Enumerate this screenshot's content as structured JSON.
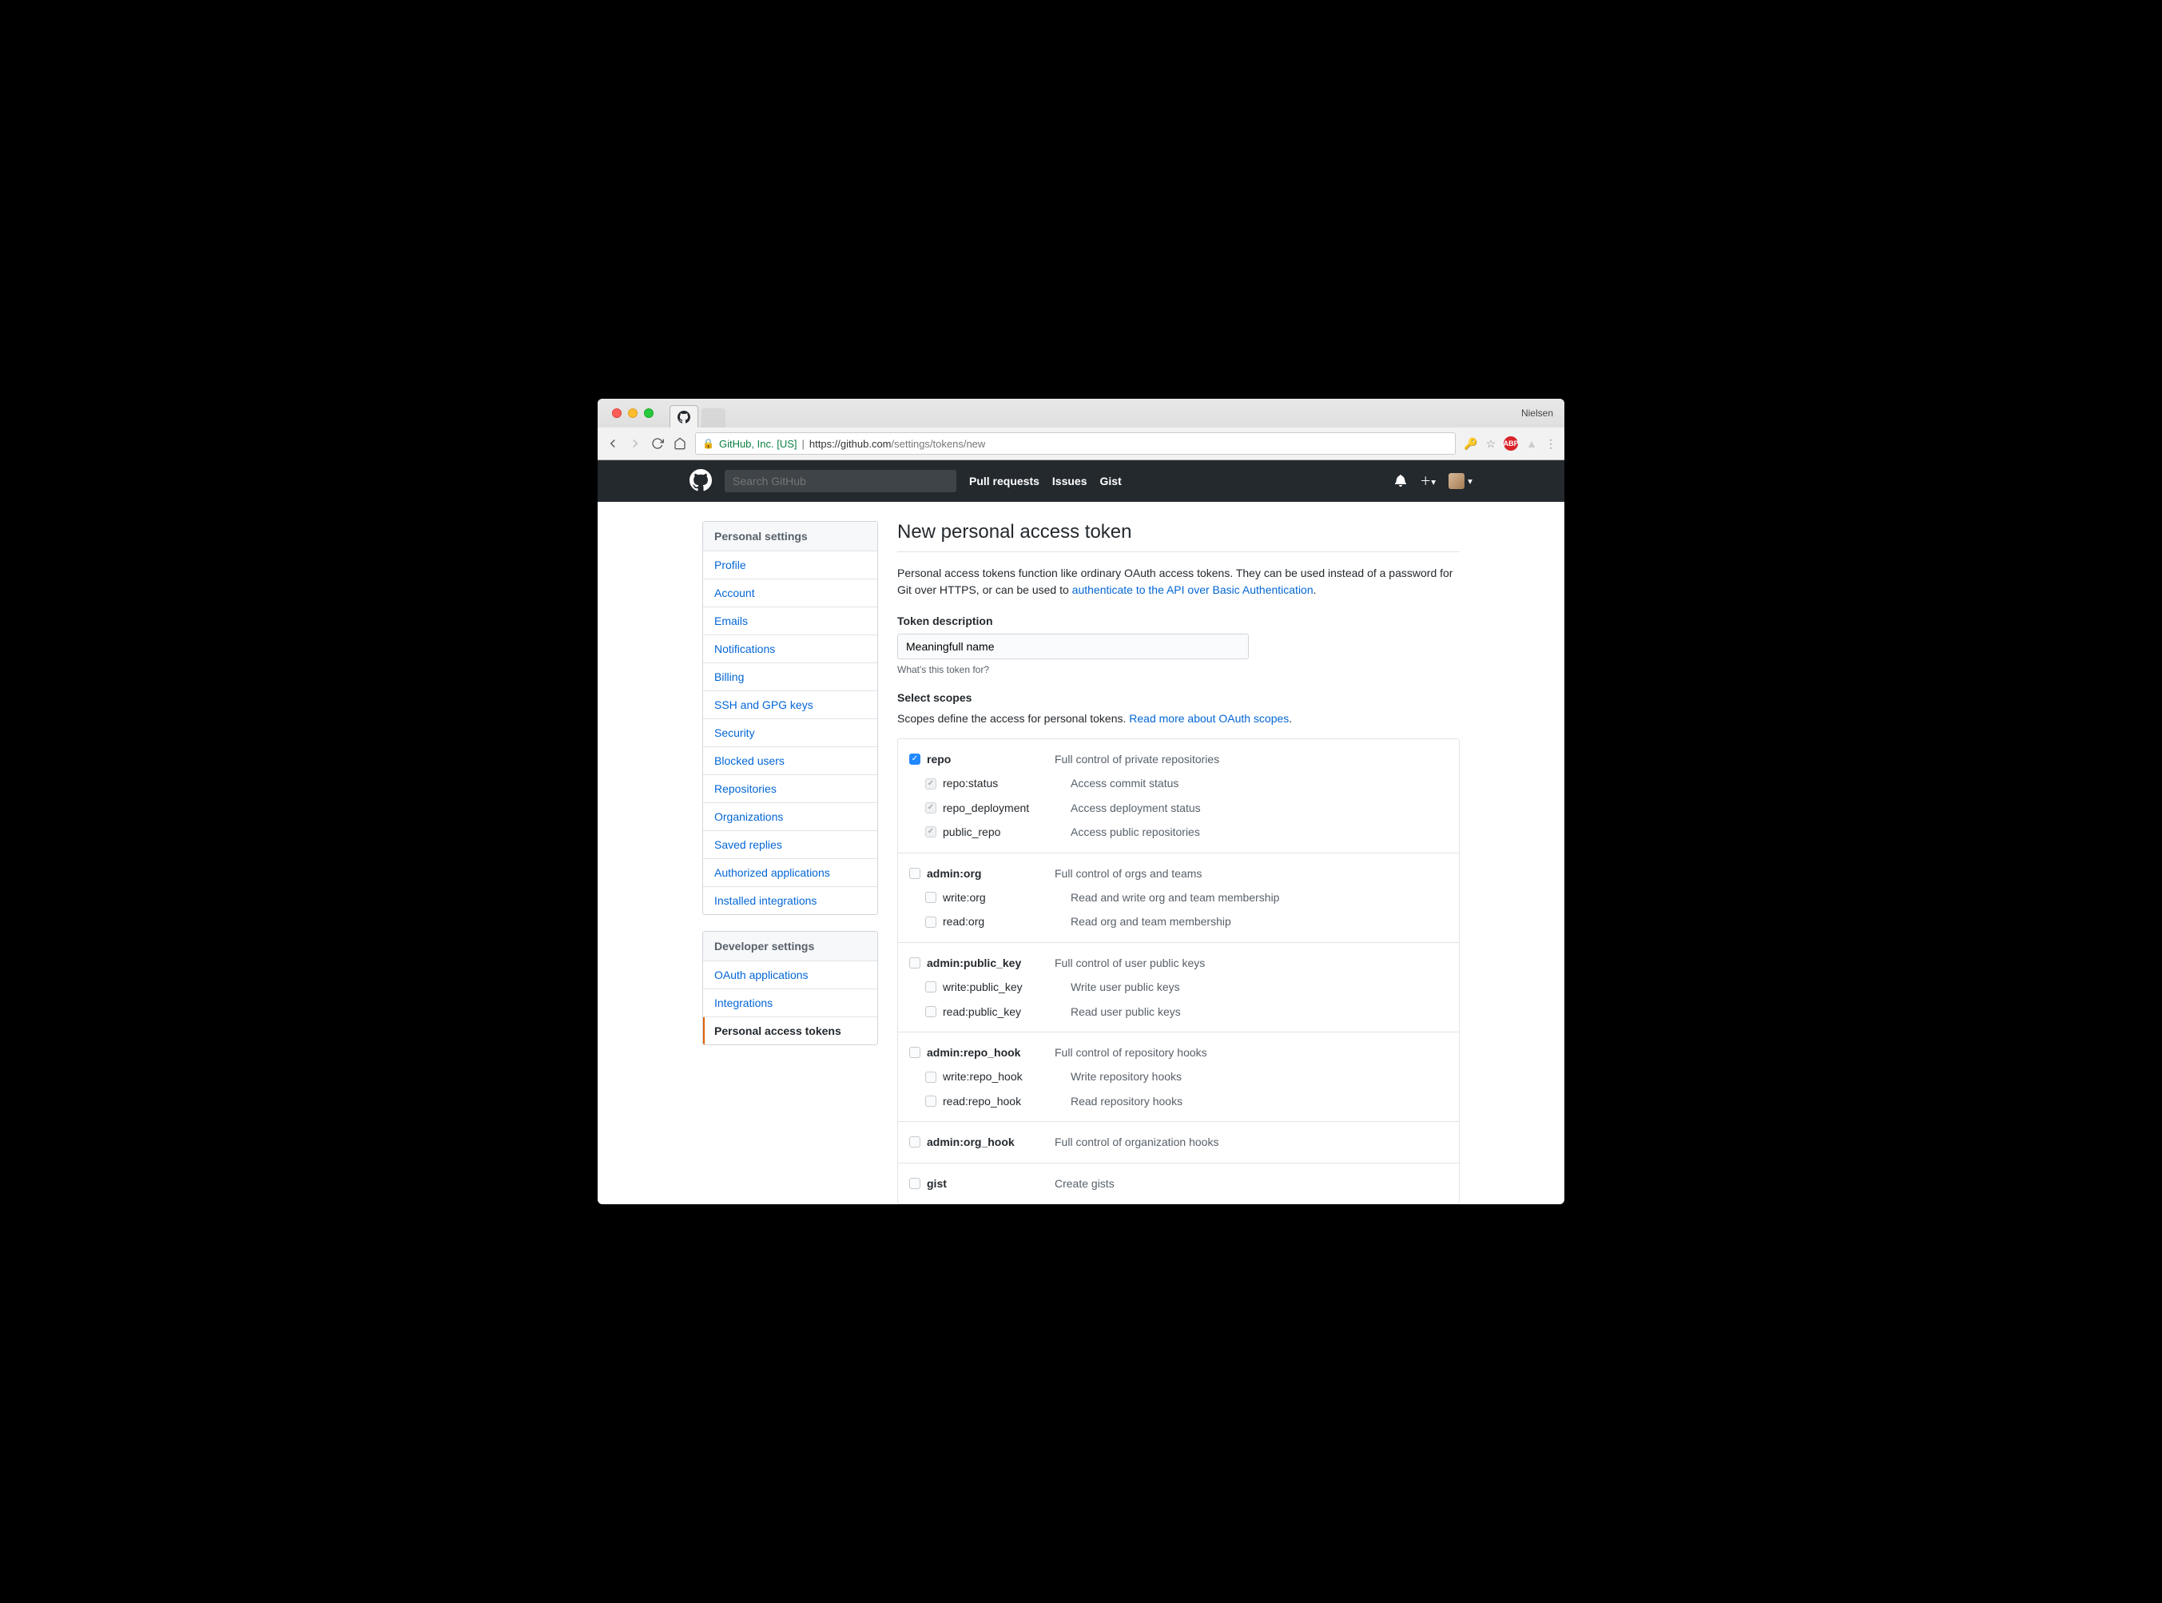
{
  "browser": {
    "profile": "Nielsen",
    "url_host_label": "GitHub, Inc. [US]",
    "url_proto": "https://",
    "url_domain": "github.com",
    "url_path": "/settings/tokens/new"
  },
  "gh_header": {
    "search_placeholder": "Search GitHub",
    "nav": [
      "Pull requests",
      "Issues",
      "Gist"
    ]
  },
  "sidebar": {
    "personal": {
      "heading": "Personal settings",
      "items": [
        "Profile",
        "Account",
        "Emails",
        "Notifications",
        "Billing",
        "SSH and GPG keys",
        "Security",
        "Blocked users",
        "Repositories",
        "Organizations",
        "Saved replies",
        "Authorized applications",
        "Installed integrations"
      ]
    },
    "developer": {
      "heading": "Developer settings",
      "items": [
        {
          "label": "OAuth applications",
          "active": false
        },
        {
          "label": "Integrations",
          "active": false
        },
        {
          "label": "Personal access tokens",
          "active": true
        }
      ]
    }
  },
  "main": {
    "title": "New personal access token",
    "intro_1": "Personal access tokens function like ordinary OAuth access tokens. They can be used instead of a password for Git over HTTPS, or can be used to ",
    "intro_link": "authenticate to the API over Basic Authentication",
    "intro_2": ".",
    "desc_label": "Token description",
    "desc_value": "Meaningfull name",
    "desc_hint": "What's this token for?",
    "scopes_label": "Select scopes",
    "scopes_intro": "Scopes define the access for personal tokens. ",
    "scopes_link": "Read more about OAuth scopes",
    "scopes_intro_2": "."
  },
  "scopes": [
    {
      "name": "repo",
      "desc": "Full control of private repositories",
      "checked": true,
      "children": [
        {
          "name": "repo:status",
          "desc": "Access commit status",
          "checked": "grey"
        },
        {
          "name": "repo_deployment",
          "desc": "Access deployment status",
          "checked": "grey"
        },
        {
          "name": "public_repo",
          "desc": "Access public repositories",
          "checked": "grey"
        }
      ]
    },
    {
      "name": "admin:org",
      "desc": "Full control of orgs and teams",
      "checked": false,
      "children": [
        {
          "name": "write:org",
          "desc": "Read and write org and team membership",
          "checked": false
        },
        {
          "name": "read:org",
          "desc": "Read org and team membership",
          "checked": false
        }
      ]
    },
    {
      "name": "admin:public_key",
      "desc": "Full control of user public keys",
      "checked": false,
      "children": [
        {
          "name": "write:public_key",
          "desc": "Write user public keys",
          "checked": false
        },
        {
          "name": "read:public_key",
          "desc": "Read user public keys",
          "checked": false
        }
      ]
    },
    {
      "name": "admin:repo_hook",
      "desc": "Full control of repository hooks",
      "checked": false,
      "children": [
        {
          "name": "write:repo_hook",
          "desc": "Write repository hooks",
          "checked": false
        },
        {
          "name": "read:repo_hook",
          "desc": "Read repository hooks",
          "checked": false
        }
      ]
    },
    {
      "name": "admin:org_hook",
      "desc": "Full control of organization hooks",
      "checked": false,
      "children": []
    },
    {
      "name": "gist",
      "desc": "Create gists",
      "checked": false,
      "children": []
    }
  ]
}
